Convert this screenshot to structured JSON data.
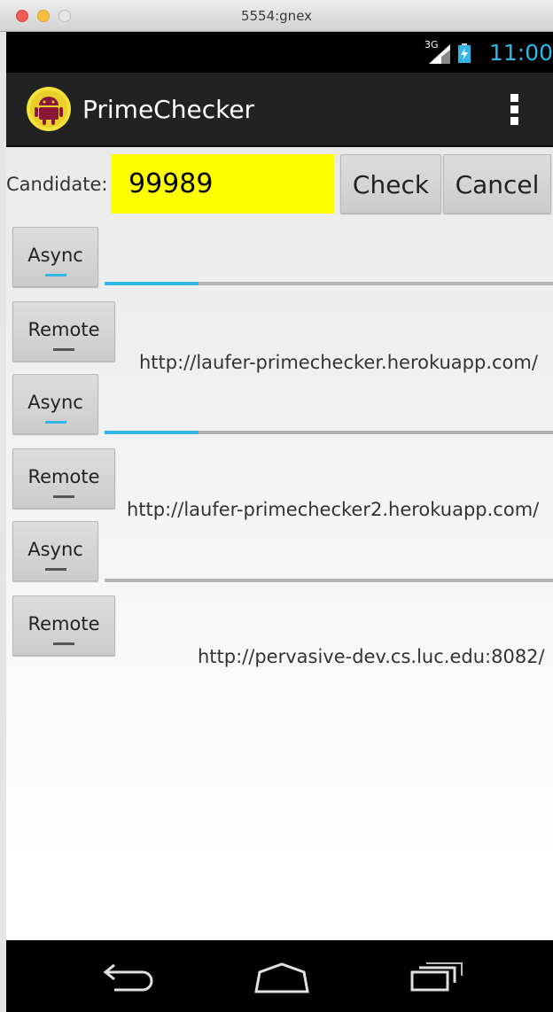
{
  "window": {
    "title": "5554:gnex"
  },
  "status_bar": {
    "network": "3G",
    "time": "11:00"
  },
  "action_bar": {
    "title": "PrimeChecker"
  },
  "candidate": {
    "label": "Candidate:",
    "value": "99989"
  },
  "buttons": {
    "check": "Check",
    "cancel": "Cancel"
  },
  "rows": [
    {
      "async_label": "Async",
      "remote_label": "Remote",
      "progress": 0.21,
      "url": "http://laufer-primechecker.herokuapp.com/"
    },
    {
      "async_label": "Async",
      "remote_label": "Remote",
      "progress": 0.21,
      "url": "http://laufer-primechecker2.herokuapp.com/"
    },
    {
      "async_label": "Async",
      "remote_label": "Remote",
      "progress": 0.0,
      "url": "http://pervasive-dev.cs.luc.edu:8082/"
    }
  ],
  "colors": {
    "accent": "#33b5e5",
    "input_bg": "#ffff00",
    "action_bar": "#222222"
  },
  "icons": {
    "back": "back-arrow-icon",
    "home": "home-icon",
    "recents": "recent-apps-icon",
    "overflow": "overflow-menu-icon",
    "app": "android-robot-icon"
  }
}
